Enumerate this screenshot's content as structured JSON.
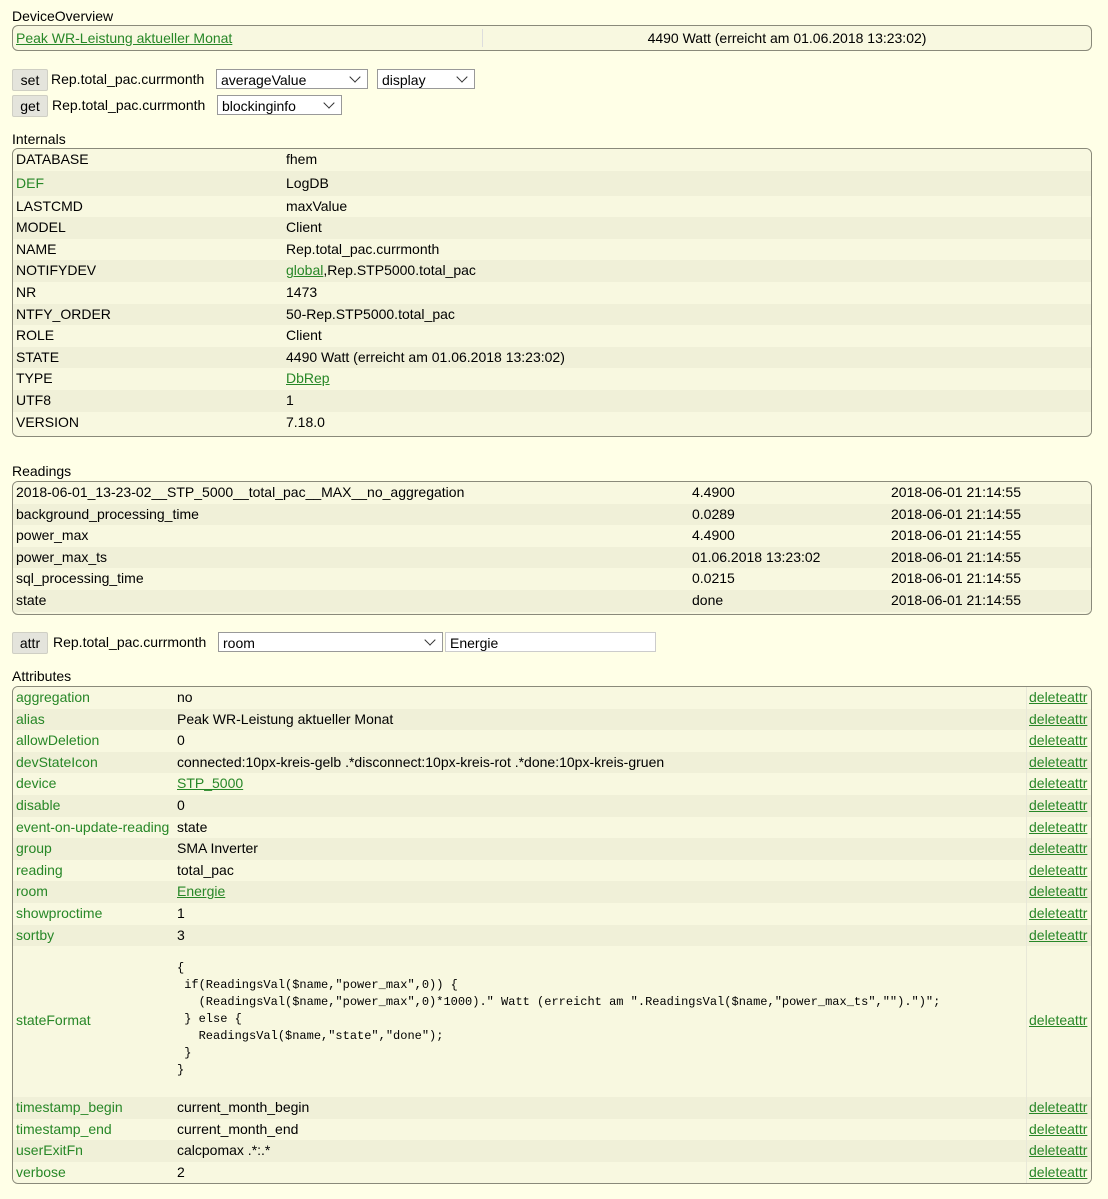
{
  "overview": {
    "title": "DeviceOverview",
    "link_label": "Peak WR-Leistung aktueller Monat",
    "state": "4490 Watt (erreicht am 01.06.2018 13:23:02)"
  },
  "set_row": {
    "button": "set",
    "device": "Rep.total_pac.currmonth",
    "select1": "averageValue",
    "select2": "display"
  },
  "get_row": {
    "button": "get",
    "device": "Rep.total_pac.currmonth",
    "select1": "blockinginfo"
  },
  "internals": {
    "title": "Internals",
    "rows": [
      {
        "key": "DATABASE",
        "value": "fhem"
      },
      {
        "key": "DEF",
        "value": "LogDB"
      },
      {
        "key": "LASTCMD",
        "value": "maxValue"
      },
      {
        "key": "MODEL",
        "value": "Client"
      },
      {
        "key": "NAME",
        "value": "Rep.total_pac.currmonth"
      },
      {
        "key": "NOTIFYDEV",
        "value_link": "global",
        "value_rest": ",Rep.STP5000.total_pac"
      },
      {
        "key": "NR",
        "value": "1473"
      },
      {
        "key": "NTFY_ORDER",
        "value": "50-Rep.STP5000.total_pac"
      },
      {
        "key": "ROLE",
        "value": "Client"
      },
      {
        "key": "STATE",
        "value": "4490 Watt (erreicht am 01.06.2018 13:23:02)"
      },
      {
        "key": "TYPE",
        "value_link": "DbRep"
      },
      {
        "key": "UTF8",
        "value": "1"
      },
      {
        "key": "VERSION",
        "value": "7.18.0"
      }
    ]
  },
  "readings": {
    "title": "Readings",
    "rows": [
      {
        "name": "2018-06-01_13-23-02__STP_5000__total_pac__MAX__no_aggregation",
        "value": "4.4900",
        "time": "2018-06-01 21:14:55"
      },
      {
        "name": "background_processing_time",
        "value": "0.0289",
        "time": "2018-06-01 21:14:55"
      },
      {
        "name": "power_max",
        "value": "4.4900",
        "time": "2018-06-01 21:14:55"
      },
      {
        "name": "power_max_ts",
        "value": "01.06.2018 13:23:02",
        "time": "2018-06-01 21:14:55"
      },
      {
        "name": "sql_processing_time",
        "value": "0.0215",
        "time": "2018-06-01 21:14:55"
      },
      {
        "name": "state",
        "value": "done",
        "time": "2018-06-01 21:14:55"
      }
    ]
  },
  "attr_row": {
    "button": "attr",
    "device": "Rep.total_pac.currmonth",
    "select": "room",
    "input_value": "Energie"
  },
  "attributes": {
    "title": "Attributes",
    "delete_label": "deleteattr",
    "rows": [
      {
        "name": "aggregation",
        "value": "no"
      },
      {
        "name": "alias",
        "value": "Peak WR-Leistung aktueller Monat"
      },
      {
        "name": "allowDeletion",
        "value": "0"
      },
      {
        "name": "devStateIcon",
        "value": "connected:10px-kreis-gelb .*disconnect:10px-kreis-rot .*done:10px-kreis-gruen"
      },
      {
        "name": "device",
        "value_link": "STP_5000"
      },
      {
        "name": "disable",
        "value": "0"
      },
      {
        "name": "event-on-update-reading",
        "value": "state"
      },
      {
        "name": "group",
        "value": "SMA Inverter"
      },
      {
        "name": "reading",
        "value": "total_pac"
      },
      {
        "name": "room",
        "value_link": "Energie"
      },
      {
        "name": "showproctime",
        "value": "1"
      },
      {
        "name": "sortby",
        "value": "3"
      },
      {
        "name": "stateFormat",
        "value_code": "{\n if(ReadingsVal($name,\"power_max\",0)) {\n   (ReadingsVal($name,\"power_max\",0)*1000).\" Watt (erreicht am \".ReadingsVal($name,\"power_max_ts\",\"\").\")\";\n } else {\n   ReadingsVal($name,\"state\",\"done\");\n }\n}"
      },
      {
        "name": "timestamp_begin",
        "value": "current_month_begin"
      },
      {
        "name": "timestamp_end",
        "value": "current_month_end"
      },
      {
        "name": "userExitFn",
        "value": "calcpomax .*:.*"
      },
      {
        "name": "verbose",
        "value": "2"
      }
    ]
  }
}
